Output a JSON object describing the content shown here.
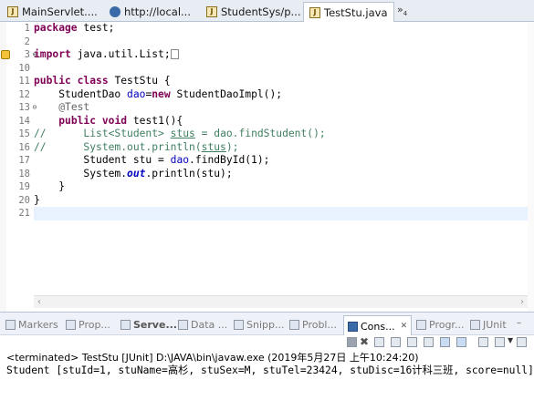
{
  "tabs": [
    {
      "label": "MainServlet....",
      "icon": "java-file-icon",
      "active": false
    },
    {
      "label": "http://local...",
      "icon": "globe-icon",
      "active": false
    },
    {
      "label": "StudentSys/p...",
      "icon": "java-file-icon",
      "active": false
    },
    {
      "label": "TestStu.java",
      "icon": "java-file-icon",
      "active": true
    }
  ],
  "tab_overflow": {
    "label": "»",
    "count": "4"
  },
  "editor": {
    "line_numbers": [
      "1",
      "2",
      "3",
      "10",
      "11",
      "12",
      "13",
      "14",
      "15",
      "16",
      "17",
      "18",
      "19",
      "20",
      "21"
    ],
    "current_line_index": 14
  },
  "views": [
    {
      "label": "Markers",
      "active": false
    },
    {
      "label": "Prop...",
      "active": false
    },
    {
      "label": "Serve...",
      "active": false
    },
    {
      "label": "Data ...",
      "active": false
    },
    {
      "label": "Snipp...",
      "active": false
    },
    {
      "label": "Probl...",
      "active": false
    },
    {
      "label": "Cons...",
      "active": true
    },
    {
      "label": "Progr...",
      "active": false
    },
    {
      "label": "JUnit",
      "active": false
    }
  ],
  "console": {
    "status": "<terminated> TestStu [JUnit] D:\\JAVA\\bin\\javaw.exe (2019年5月27日 上午10:24:20)",
    "output": "Student [stuId=1, stuName=高杉, stuSex=M, stuTel=23424, stuDisc=16计科三班, score=null]"
  }
}
